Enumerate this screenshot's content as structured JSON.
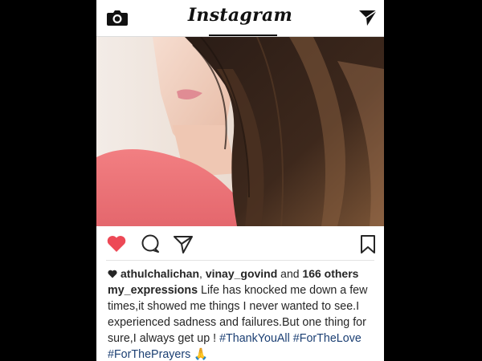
{
  "header": {
    "brand": "Instagram",
    "camera_icon": "camera-icon",
    "direct_icon": "paper-plane-icon"
  },
  "post": {
    "image_icon": "photo",
    "actions": {
      "like_icon": "heart-icon",
      "comment_icon": "comment-icon",
      "share_icon": "paper-plane-icon",
      "save_icon": "bookmark-icon"
    },
    "likes": {
      "user1": "athulchalichan",
      "sep": ", ",
      "user2": "vinay_govind",
      "and_text": " and ",
      "others": "166 others"
    },
    "caption": {
      "username": "my_expressions",
      "text": " Life has knocked me down a few times,it showed me things I never wanted to see.I experienced sadness and failures.But one thing for sure,I always get up ! ",
      "tag1": "#ThankYouAll",
      "tag2": "#ForTheLove",
      "tag3": "#ForThePrayers",
      "emoji": "🙏"
    }
  },
  "colors": {
    "like_red": "#ed4956",
    "hashtag": "#1b3f73",
    "text": "#262626"
  }
}
